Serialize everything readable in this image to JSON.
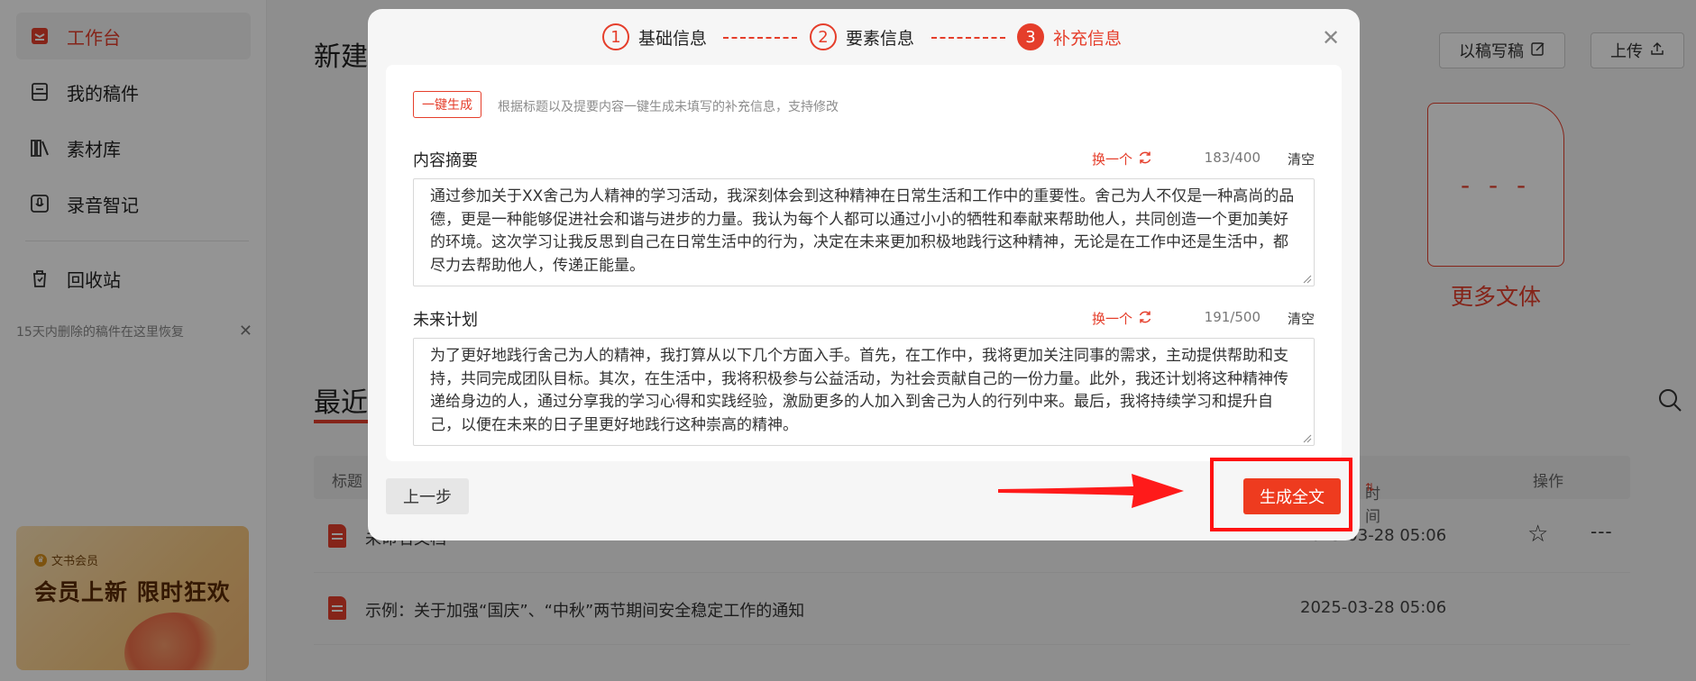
{
  "sidebar": {
    "items": [
      {
        "label": "工作台",
        "icon": "workbench-icon"
      },
      {
        "label": "我的稿件",
        "icon": "manuscripts-icon"
      },
      {
        "label": "素材库",
        "icon": "library-icon"
      },
      {
        "label": "录音智记",
        "icon": "recording-icon"
      },
      {
        "label": "回收站",
        "icon": "trash-icon"
      }
    ],
    "trash_hint": "15天内删除的稿件在这里恢复",
    "promo": {
      "tag": "文书会员",
      "title": "会员上新 限时狂欢"
    }
  },
  "main": {
    "title": "新建",
    "write_by_draft_label": "以稿写稿",
    "upload_label": "上传",
    "more_types_label": "更多文体",
    "recent_title": "最近",
    "table_headers": {
      "title": "标题",
      "time": "时间",
      "action": "操作"
    },
    "rows": [
      {
        "title": "未命名文档",
        "time": "2025-03-28 05:06"
      },
      {
        "title": "示例：关于加强“国庆”、“中秋”两节期间安全稳定工作的通知",
        "time": "2025-03-28 05:06"
      }
    ]
  },
  "modal": {
    "steps": [
      {
        "num": "1",
        "label": "基础信息"
      },
      {
        "num": "2",
        "label": "要素信息"
      },
      {
        "num": "3",
        "label": "补充信息"
      }
    ],
    "active_step": 3,
    "one_click_label": "一键生成",
    "one_click_hint": "根据标题以及提要内容一键生成未填写的补充信息，支持修改",
    "fields": [
      {
        "label": "内容摘要",
        "swap_label": "换一个",
        "count": "183/400",
        "clear_label": "清空",
        "value": "通过参加关于XX舍己为人精神的学习活动，我深刻体会到这种精神在日常生活和工作中的重要性。舍己为人不仅是一种高尚的品德，更是一种能够促进社会和谐与进步的力量。我认为每个人都可以通过小小的牺牲和奉献来帮助他人，共同创造一个更加美好的环境。这次学习让我反思到自己在日常生活中的行为，决定在未来更加积极地践行这种精神，无论是在工作中还是生活中，都尽力去帮助他人，传递正能量。"
      },
      {
        "label": "未来计划",
        "swap_label": "换一个",
        "count": "191/500",
        "clear_label": "清空",
        "value": "为了更好地践行舍己为人的精神，我打算从以下几个方面入手。首先，在工作中，我将更加关注同事的需求，主动提供帮助和支持，共同完成团队目标。其次，在生活中，我将积极参与公益活动，为社会贡献自己的一份力量。此外，我还计划将这种精神传递给身边的人，通过分享我的学习心得和实践经验，激励更多的人加入到舍己为人的行列中来。最后，我将持续学习和提升自己，以便在未来的日子里更好地践行这种崇高的精神。"
      }
    ],
    "prev_label": "上一步",
    "submit_label": "生成全文"
  },
  "colors": {
    "accent": "#e53e2b",
    "annotation": "#ff1010"
  }
}
